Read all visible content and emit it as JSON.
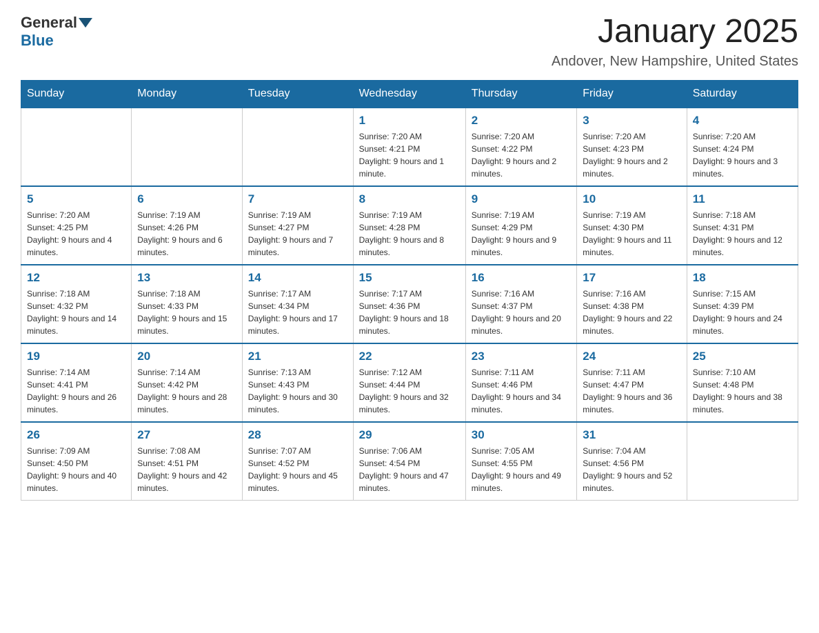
{
  "logo": {
    "general": "General",
    "blue": "Blue"
  },
  "header": {
    "month_title": "January 2025",
    "location": "Andover, New Hampshire, United States"
  },
  "days_of_week": [
    "Sunday",
    "Monday",
    "Tuesday",
    "Wednesday",
    "Thursday",
    "Friday",
    "Saturday"
  ],
  "weeks": [
    {
      "days": [
        {
          "number": "",
          "info": ""
        },
        {
          "number": "",
          "info": ""
        },
        {
          "number": "",
          "info": ""
        },
        {
          "number": "1",
          "info": "Sunrise: 7:20 AM\nSunset: 4:21 PM\nDaylight: 9 hours and 1 minute."
        },
        {
          "number": "2",
          "info": "Sunrise: 7:20 AM\nSunset: 4:22 PM\nDaylight: 9 hours and 2 minutes."
        },
        {
          "number": "3",
          "info": "Sunrise: 7:20 AM\nSunset: 4:23 PM\nDaylight: 9 hours and 2 minutes."
        },
        {
          "number": "4",
          "info": "Sunrise: 7:20 AM\nSunset: 4:24 PM\nDaylight: 9 hours and 3 minutes."
        }
      ]
    },
    {
      "days": [
        {
          "number": "5",
          "info": "Sunrise: 7:20 AM\nSunset: 4:25 PM\nDaylight: 9 hours and 4 minutes."
        },
        {
          "number": "6",
          "info": "Sunrise: 7:19 AM\nSunset: 4:26 PM\nDaylight: 9 hours and 6 minutes."
        },
        {
          "number": "7",
          "info": "Sunrise: 7:19 AM\nSunset: 4:27 PM\nDaylight: 9 hours and 7 minutes."
        },
        {
          "number": "8",
          "info": "Sunrise: 7:19 AM\nSunset: 4:28 PM\nDaylight: 9 hours and 8 minutes."
        },
        {
          "number": "9",
          "info": "Sunrise: 7:19 AM\nSunset: 4:29 PM\nDaylight: 9 hours and 9 minutes."
        },
        {
          "number": "10",
          "info": "Sunrise: 7:19 AM\nSunset: 4:30 PM\nDaylight: 9 hours and 11 minutes."
        },
        {
          "number": "11",
          "info": "Sunrise: 7:18 AM\nSunset: 4:31 PM\nDaylight: 9 hours and 12 minutes."
        }
      ]
    },
    {
      "days": [
        {
          "number": "12",
          "info": "Sunrise: 7:18 AM\nSunset: 4:32 PM\nDaylight: 9 hours and 14 minutes."
        },
        {
          "number": "13",
          "info": "Sunrise: 7:18 AM\nSunset: 4:33 PM\nDaylight: 9 hours and 15 minutes."
        },
        {
          "number": "14",
          "info": "Sunrise: 7:17 AM\nSunset: 4:34 PM\nDaylight: 9 hours and 17 minutes."
        },
        {
          "number": "15",
          "info": "Sunrise: 7:17 AM\nSunset: 4:36 PM\nDaylight: 9 hours and 18 minutes."
        },
        {
          "number": "16",
          "info": "Sunrise: 7:16 AM\nSunset: 4:37 PM\nDaylight: 9 hours and 20 minutes."
        },
        {
          "number": "17",
          "info": "Sunrise: 7:16 AM\nSunset: 4:38 PM\nDaylight: 9 hours and 22 minutes."
        },
        {
          "number": "18",
          "info": "Sunrise: 7:15 AM\nSunset: 4:39 PM\nDaylight: 9 hours and 24 minutes."
        }
      ]
    },
    {
      "days": [
        {
          "number": "19",
          "info": "Sunrise: 7:14 AM\nSunset: 4:41 PM\nDaylight: 9 hours and 26 minutes."
        },
        {
          "number": "20",
          "info": "Sunrise: 7:14 AM\nSunset: 4:42 PM\nDaylight: 9 hours and 28 minutes."
        },
        {
          "number": "21",
          "info": "Sunrise: 7:13 AM\nSunset: 4:43 PM\nDaylight: 9 hours and 30 minutes."
        },
        {
          "number": "22",
          "info": "Sunrise: 7:12 AM\nSunset: 4:44 PM\nDaylight: 9 hours and 32 minutes."
        },
        {
          "number": "23",
          "info": "Sunrise: 7:11 AM\nSunset: 4:46 PM\nDaylight: 9 hours and 34 minutes."
        },
        {
          "number": "24",
          "info": "Sunrise: 7:11 AM\nSunset: 4:47 PM\nDaylight: 9 hours and 36 minutes."
        },
        {
          "number": "25",
          "info": "Sunrise: 7:10 AM\nSunset: 4:48 PM\nDaylight: 9 hours and 38 minutes."
        }
      ]
    },
    {
      "days": [
        {
          "number": "26",
          "info": "Sunrise: 7:09 AM\nSunset: 4:50 PM\nDaylight: 9 hours and 40 minutes."
        },
        {
          "number": "27",
          "info": "Sunrise: 7:08 AM\nSunset: 4:51 PM\nDaylight: 9 hours and 42 minutes."
        },
        {
          "number": "28",
          "info": "Sunrise: 7:07 AM\nSunset: 4:52 PM\nDaylight: 9 hours and 45 minutes."
        },
        {
          "number": "29",
          "info": "Sunrise: 7:06 AM\nSunset: 4:54 PM\nDaylight: 9 hours and 47 minutes."
        },
        {
          "number": "30",
          "info": "Sunrise: 7:05 AM\nSunset: 4:55 PM\nDaylight: 9 hours and 49 minutes."
        },
        {
          "number": "31",
          "info": "Sunrise: 7:04 AM\nSunset: 4:56 PM\nDaylight: 9 hours and 52 minutes."
        },
        {
          "number": "",
          "info": ""
        }
      ]
    }
  ]
}
